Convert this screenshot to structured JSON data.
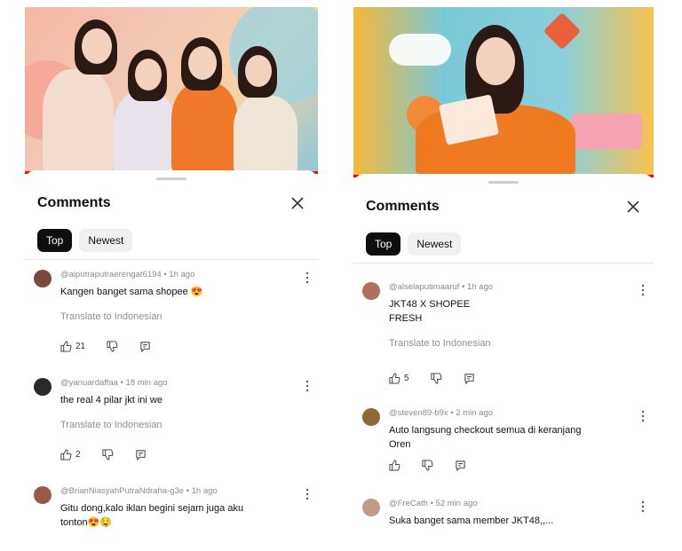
{
  "left": {
    "sheet": {
      "title": "Comments",
      "tabs": [
        {
          "label": "Top",
          "active": true
        },
        {
          "label": "Newest",
          "active": false
        }
      ]
    },
    "progress_fraction": 1.0,
    "comments": [
      {
        "author": "@aiputraputraerengat6194",
        "time": "1h ago",
        "text_lines": [
          "Kangen banget sama shopee 😍"
        ],
        "translate": "Translate to Indonesian",
        "likes": "21",
        "avatar_color": "#7b4a3a"
      },
      {
        "author": "@yanuardaffaa",
        "time": "18 min ago",
        "text_lines": [
          "the real 4 pilar jkt ini  we"
        ],
        "translate": "Translate to Indonesian",
        "likes": "2",
        "avatar_color": "#2a2a2a"
      },
      {
        "author": "@BrianNiasyahPutraNdraha-g3e",
        "time": "1h ago",
        "text_lines": [
          "Gitu dong,kalo iklan begini sejam juga aku",
          "tonton😍🤤"
        ],
        "translate": "",
        "likes": "",
        "avatar_color": "#9a5a4a"
      }
    ]
  },
  "right": {
    "sheet": {
      "title": "Comments",
      "tabs": [
        {
          "label": "Top",
          "active": true
        },
        {
          "label": "Newest",
          "active": false
        }
      ]
    },
    "progress_fraction": 1.0,
    "comments": [
      {
        "author": "@alselaputimaaruf",
        "time": "1h ago",
        "text_lines": [
          "JKT48 X SHOPEE",
          "FRESH"
        ],
        "translate": "Translate to Indonesian",
        "likes": "5",
        "avatar_color": "#b07060"
      },
      {
        "author": "@steven89-b9x",
        "time": "2 min ago",
        "text_lines": [
          "Auto langsung checkout semua di keranjang",
          "Oren"
        ],
        "translate": "",
        "likes": "",
        "avatar_color": "#8a6a3a"
      },
      {
        "author": "@FreCath",
        "time": "52 min ago",
        "text_lines": [
          "Suka banget sama member JKT48,,..."
        ],
        "translate": "",
        "likes": "",
        "avatar_color": "#c29a8a"
      }
    ]
  },
  "icons": {
    "close": "close-icon",
    "like": "thumbs-up-icon",
    "dislike": "thumbs-down-icon",
    "reply": "reply-icon",
    "more": "more-vertical-icon"
  },
  "colors": {
    "progress": "#ff0000",
    "chip_active_bg": "#0f0f0f",
    "chip_bg": "#f0f0f0",
    "meta_text": "#8a8a8a"
  }
}
